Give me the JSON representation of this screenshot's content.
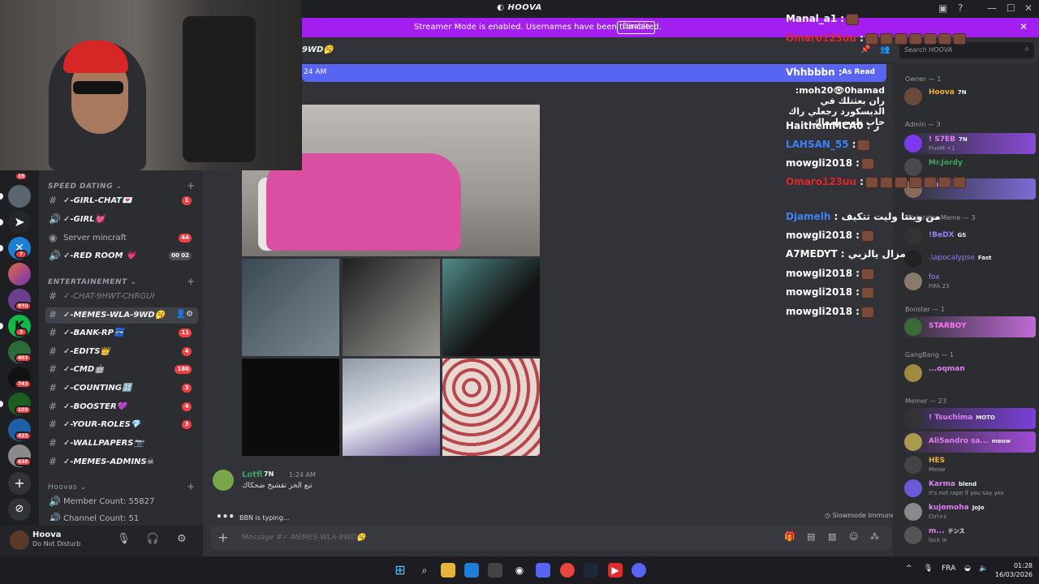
{
  "app": {
    "title": "HOOVA",
    "streamer_banner": "Streamer Mode is enabled. Usernames have been truncated.",
    "banner_button": "Disable"
  },
  "rail_badges": [
    "19",
    "7",
    "970",
    "3",
    "403",
    "743",
    "109",
    "425",
    "638"
  ],
  "channels": {
    "cat_speed": "SPEED DATING",
    "cat_ent": "ENTERTAINEMENT",
    "cat_hoovas": "Hoovas",
    "items": [
      {
        "name": "✓-GIRL-CHAT💌",
        "badge": "1"
      },
      {
        "name": "✓-GIRL💓",
        "badge": ""
      },
      {
        "name": "Server mincraft",
        "badge": "44"
      },
      {
        "name": "✓-RED ROOM 💗",
        "badge": "00 02"
      },
      {
        "name": "✓-CHAT-9HWT-CHRGUI",
        "badge": ""
      },
      {
        "name": "✓-MEMES-WLA-9WD🥱",
        "badge": ""
      },
      {
        "name": "✓-BANK-RP🏧",
        "badge": "11"
      },
      {
        "name": "✓-EDITS👑",
        "badge": "4"
      },
      {
        "name": "✓-CMD🤖",
        "badge": "186"
      },
      {
        "name": "✓-COUNTING🔢",
        "badge": "3"
      },
      {
        "name": "✓-BOOSTER💜",
        "badge": "4"
      },
      {
        "name": "✓-YOUR-ROLES💎",
        "badge": "3"
      },
      {
        "name": "✓-WALLPAPERS📷",
        "badge": ""
      },
      {
        "name": "✓-MEMES-ADMINS☠",
        "badge": ""
      },
      {
        "name": "Member Count: 55827",
        "badge": ""
      },
      {
        "name": "Channel Count: 51",
        "badge": ""
      }
    ]
  },
  "user": {
    "name": "Hoova",
    "status": "Do Not Disturb"
  },
  "chat": {
    "header": "9WD🥱",
    "new_bar_time": "24 AM",
    "mark_read": "As Read",
    "message": {
      "author": "Lotfi",
      "tag": "7N",
      "time": "1:24 AM",
      "text": "تبع الخر تقشيخ ضحكاك"
    },
    "typing": "BBN is typing...",
    "slowmode": "Slowmode Immune",
    "placeholder": "Message #✓-MEMES-WLA-9WD🥱"
  },
  "overlay": [
    {
      "user": "Manal_a1",
      "text": ":",
      "color": "#ffffff",
      "emotes": 1
    },
    {
      "user": "Omaro123uu",
      "text": ":",
      "color": "#e0262b",
      "emotes": 8
    },
    {
      "user": "Vhhbbbn",
      "text": ":",
      "color": "#ffffff",
      "emotes": 0
    },
    {
      "user": "moh20👁0hamad",
      "text": ": ران بعثتلك في الديسكورد رجعلي راك حاب نلعب امعاك",
      "color": "#ffffff",
      "emotes": 0
    },
    {
      "user": "HaithemMCA0",
      "text": ": ر",
      "color": "#ffffff",
      "emotes": 0
    },
    {
      "user": "LAHSAN_55",
      "text": ":",
      "color": "#3b82f6",
      "emotes": 1
    },
    {
      "user": "mowgli2018",
      "text": ":",
      "color": "#ffffff",
      "emotes": 1
    },
    {
      "user": "Omaro123uu",
      "text": ":",
      "color": "#e0262b",
      "emotes": 7
    },
    {
      "user": "Djamelh",
      "text": ": من وينتا وليت تتكيف",
      "color": "#3b82f6",
      "emotes": 0
    },
    {
      "user": "mowgli2018",
      "text": ":",
      "color": "#ffffff",
      "emotes": 1
    },
    {
      "user": "A7MEDYT",
      "text": ": مزال يالزبي",
      "color": "#ffffff",
      "emotes": 0
    },
    {
      "user": "mowgli2018",
      "text": ":",
      "color": "#ffffff",
      "emotes": 1
    },
    {
      "user": "mowgli2018",
      "text": ":",
      "color": "#ffffff",
      "emotes": 1
    },
    {
      "user": "mowgli2018",
      "text": ":",
      "color": "#ffffff",
      "emotes": 1
    }
  ],
  "members": {
    "search_placeholder": "Search HOOVA",
    "groups": [
      {
        "label": "Owner — 1",
        "items": [
          {
            "name": "Hoova",
            "tag": "7N",
            "sub": "",
            "color": "#f0b232"
          }
        ]
      },
      {
        "label": "Admin — 3",
        "items": [
          {
            "name": "! S7EB",
            "tag": "7N",
            "sub": "FiveM +1",
            "color": "#e27ff5"
          },
          {
            "name": "Mr.Jordy",
            "tag": "",
            "sub": "",
            "color": "#3ba55d"
          },
          {
            "name": "Salah",
            "tag": "",
            "sub": "",
            "color": "#e27ff5"
          }
        ]
      },
      {
        "label": "Moderator Meme — 3",
        "items": [
          {
            "name": "!BeDX",
            "tag": "GS",
            "sub": "",
            "color": "#9b7ff5"
          },
          {
            "name": ".\\apocalypse",
            "tag": "Fast",
            "sub": "",
            "color": "#9b7ff5"
          },
          {
            "name": "fox",
            "tag": "",
            "sub": "FIFA 23",
            "color": "#9b7ff5"
          }
        ]
      },
      {
        "label": "Booster — 1",
        "items": [
          {
            "name": "STARBOY",
            "tag": "",
            "sub": "",
            "color": "#ff73fa"
          }
        ]
      },
      {
        "label": "GangBang — 1",
        "items": [
          {
            "name": "...oqman",
            "tag": "",
            "sub": "",
            "color": "#e27ff5"
          }
        ]
      },
      {
        "label": "Memer — 23",
        "items": [
          {
            "name": "! Tsuchima",
            "tag": "MOTO",
            "sub": "",
            "color": "#e27ff5"
          },
          {
            "name": "Ali5andro sa...",
            "tag": "meow",
            "sub": "",
            "color": "#e27ff5"
          },
          {
            "name": "HES",
            "tag": "",
            "sub": "Meow",
            "color": "#f0b232"
          },
          {
            "name": "Karma",
            "tag": "blend",
            "sub": "It's not rape if you say yes",
            "color": "#e27ff5"
          },
          {
            "name": "kujomoha",
            "tag": "JoJo",
            "sub": "Ctrl+s",
            "color": "#e27ff5"
          },
          {
            "name": "m...",
            "tag": "テンス",
            "sub": "lock in",
            "color": "#e27ff5"
          }
        ]
      }
    ]
  },
  "taskbar": {
    "lang": "FRA",
    "time": "01:28",
    "date": "16/03/2026"
  },
  "colors": {
    "banner": "#a21ff0",
    "accent": "#5865f2",
    "background": "#313338"
  }
}
